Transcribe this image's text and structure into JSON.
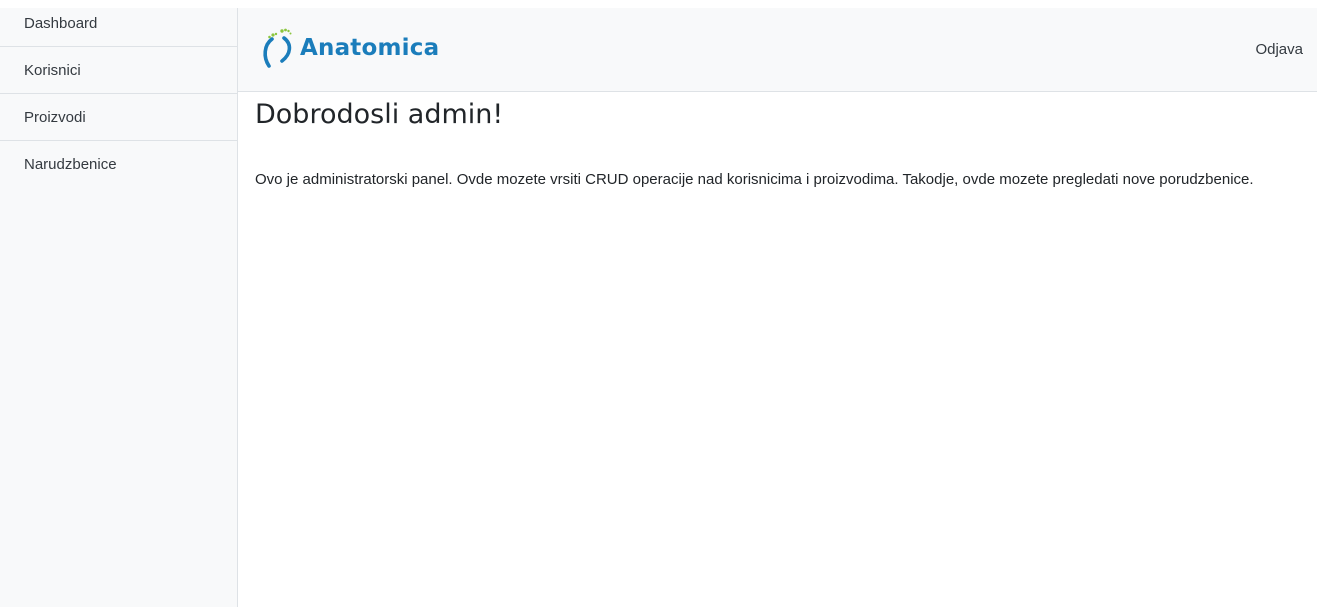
{
  "sidebar": {
    "items": [
      {
        "label": "Dashboard"
      },
      {
        "label": "Korisnici"
      },
      {
        "label": "Proizvodi"
      },
      {
        "label": "Narudzbenice"
      }
    ]
  },
  "header": {
    "brand_name": "Anatomica",
    "logout_label": "Odjava",
    "colors": {
      "brand_blue": "#1b7dbb",
      "brand_green": "#8cc63f"
    }
  },
  "main": {
    "title": "Dobrodosli admin!",
    "description": "Ovo je administratorski panel. Ovde mozete vrsiti CRUD operacije nad korisnicima i proizvodima. Takodje, ovde mozete pregledati nove porudzbenice."
  }
}
